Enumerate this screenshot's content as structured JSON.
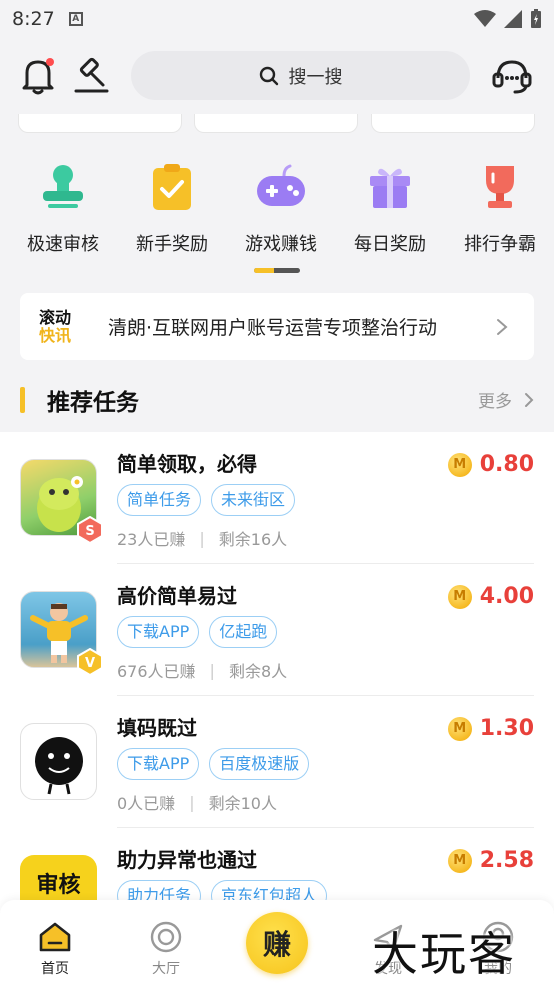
{
  "status_bar": {
    "time": "8:27",
    "sim_letter": "A"
  },
  "header": {
    "search_placeholder": "搜一搜",
    "icons": [
      "bell-icon",
      "hammer-icon",
      "search-icon",
      "customer-service-icon"
    ],
    "notification_dot_color": "#ff4d4f"
  },
  "quick_entries": [
    {
      "label": "极速审核",
      "icon": "stamp-icon",
      "color": "#3ccaa0"
    },
    {
      "label": "新手奖励",
      "icon": "clipboard-check-icon",
      "color": "#f6c028"
    },
    {
      "label": "游戏赚钱",
      "icon": "gamepad-icon",
      "color": "#9b7cf3"
    },
    {
      "label": "每日奖励",
      "icon": "gift-icon",
      "color": "#a98af5"
    },
    {
      "label": "排行争霸",
      "icon": "trophy-icon",
      "color": "#f26a5c"
    }
  ],
  "news": {
    "badge_line1": "滚动",
    "badge_line2": "快讯",
    "text": "清朗·互联网用户账号运营专项整治行动"
  },
  "section": {
    "title": "推荐任务",
    "more": "更多"
  },
  "tasks": [
    {
      "title": "简单领取，必得",
      "tags": [
        "简单任务",
        "未来街区"
      ],
      "earned": "23人已赚",
      "remaining": "剩余16人",
      "reward": "0.80",
      "coin": "M",
      "badge": "S"
    },
    {
      "title": "高价简单易过",
      "tags": [
        "下载APP",
        "亿起跑"
      ],
      "earned": "676人已赚",
      "remaining": "剩余8人",
      "reward": "4.00",
      "coin": "M",
      "badge": "V"
    },
    {
      "title": "填码既过",
      "tags": [
        "下载APP",
        "百度极速版"
      ],
      "earned": "0人已赚",
      "remaining": "剩余10人",
      "reward": "1.30",
      "coin": "M",
      "badge": ""
    },
    {
      "title": "助力异常也通过",
      "tags": [
        "助力任务",
        "京东红包超人"
      ],
      "earned": "",
      "remaining": "",
      "reward": "2.58",
      "coin": "M",
      "badge": "",
      "thumb_text": "审核"
    }
  ],
  "bottom_nav": {
    "items": [
      {
        "label": "首页",
        "icon": "home-icon",
        "active": true
      },
      {
        "label": "大厅",
        "icon": "target-icon",
        "active": false
      },
      {
        "label": "赚",
        "icon": "earn-icon",
        "active": false
      },
      {
        "label": "发现",
        "icon": "discover-icon",
        "active": false
      },
      {
        "label": "我的",
        "icon": "profile-icon",
        "active": false
      }
    ]
  },
  "watermark": "大玩客",
  "colors": {
    "accent": "#f6c028",
    "reward": "#e8403a",
    "tag": "#3d9be9"
  }
}
